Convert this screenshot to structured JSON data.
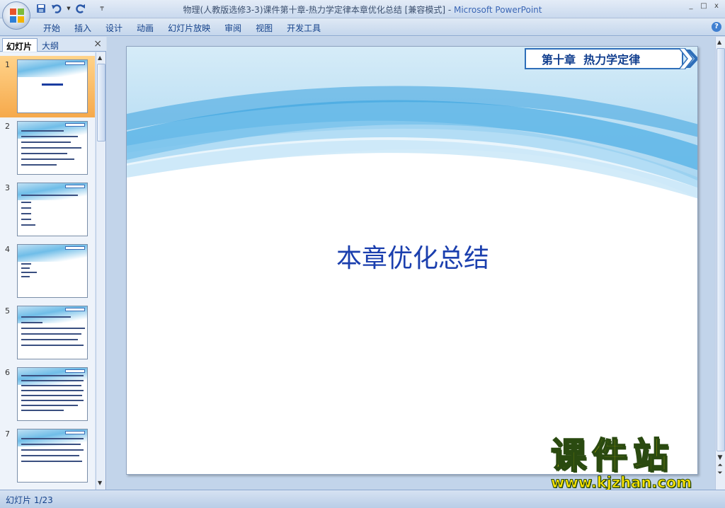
{
  "window": {
    "title": "物理(人教版选修3-3)课件第十章-热力学定律本章优化总结 [兼容模式] - ",
    "app_name": "Microsoft PowerPoint",
    "minimize": "_",
    "maximize": "□",
    "close": "x"
  },
  "quick_access": [
    "save-icon",
    "undo-icon",
    "redo-icon",
    "customize-icon"
  ],
  "ribbon": {
    "tabs": [
      "开始",
      "插入",
      "设计",
      "动画",
      "幻灯片放映",
      "审阅",
      "视图",
      "开发工具"
    ],
    "help": "?"
  },
  "left_pane": {
    "tabs": [
      "幻灯片",
      "大纲"
    ],
    "close": "×",
    "slides": [
      {
        "number": "1",
        "selected": true
      },
      {
        "number": "2",
        "selected": false
      },
      {
        "number": "3",
        "selected": false
      },
      {
        "number": "4",
        "selected": false
      },
      {
        "number": "5",
        "selected": false
      },
      {
        "number": "6",
        "selected": false
      },
      {
        "number": "7",
        "selected": false
      }
    ]
  },
  "slide": {
    "chapter": "第十章  热力学定律",
    "title": "本章优化总结"
  },
  "watermark": {
    "title": "课件站",
    "url": "www.kjzhan.com"
  },
  "status": {
    "slide_count": "幻灯片 1/23"
  },
  "colors": {
    "accent": "#15428b",
    "slide_title": "#1b3fae",
    "selected_thumb": "#f6a94b",
    "watermark": "#ffe600"
  }
}
